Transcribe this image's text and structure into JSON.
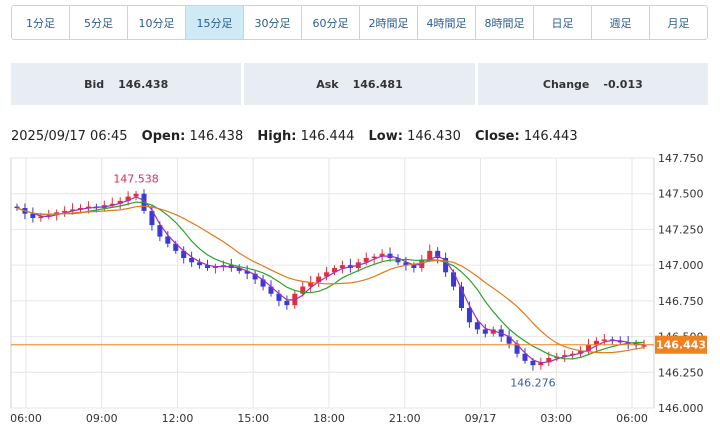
{
  "tabs": [
    {
      "label": "1分足",
      "active": false
    },
    {
      "label": "5分足",
      "active": false
    },
    {
      "label": "10分足",
      "active": false
    },
    {
      "label": "15分足",
      "active": true
    },
    {
      "label": "30分足",
      "active": false
    },
    {
      "label": "60分足",
      "active": false
    },
    {
      "label": "2時間足",
      "active": false
    },
    {
      "label": "4時間足",
      "active": false
    },
    {
      "label": "8時間足",
      "active": false
    },
    {
      "label": "日足",
      "active": false
    },
    {
      "label": "週足",
      "active": false
    },
    {
      "label": "月足",
      "active": false
    }
  ],
  "quotes": {
    "bid_label": "Bid",
    "bid_value": "146.438",
    "ask_label": "Ask",
    "ask_value": "146.481",
    "change_label": "Change",
    "change_value": "-0.013"
  },
  "ohlc": {
    "datetime": "2025/09/17 06:45",
    "open_label": "Open:",
    "open": "146.438",
    "high_label": "High:",
    "high": "146.444",
    "low_label": "Low:",
    "low": "146.430",
    "close_label": "Close:",
    "close": "146.443"
  },
  "chart_data": {
    "type": "candlestick",
    "y_ticks": [
      "147.750",
      "147.500",
      "147.250",
      "147.000",
      "146.750",
      "146.500",
      "146.250",
      "146.000"
    ],
    "ylim": [
      146.0,
      147.75
    ],
    "x_ticks": [
      "06:00",
      "09:00",
      "12:00",
      "15:00",
      "18:00",
      "21:00",
      "09/17",
      "03:00",
      "06:00"
    ],
    "current_price": "146.443",
    "high_annotation": "147.538",
    "low_annotation": "146.276",
    "colors": {
      "up": "#e0303c",
      "down": "#3a3ad0",
      "ma_fast": "#9b2fc9",
      "ma_mid": "#2aa52a",
      "ma_slow": "#e07a1a",
      "price_line": "#f08020",
      "grid": "#e6e6e6"
    },
    "closes": [
      147.4,
      147.36,
      147.33,
      147.34,
      147.35,
      147.37,
      147.38,
      147.39,
      147.4,
      147.41,
      147.4,
      147.42,
      147.43,
      147.45,
      147.48,
      147.5,
      147.38,
      147.28,
      147.2,
      147.15,
      147.1,
      147.05,
      147.02,
      147.0,
      146.98,
      146.99,
      147.0,
      146.98,
      146.96,
      146.94,
      146.9,
      146.85,
      146.8,
      146.75,
      146.72,
      146.8,
      146.85,
      146.88,
      146.92,
      146.95,
      146.98,
      147.0,
      146.98,
      147.02,
      147.05,
      147.06,
      147.08,
      147.05,
      147.02,
      147.0,
      146.98,
      147.04,
      147.1,
      147.05,
      146.95,
      146.85,
      146.7,
      146.6,
      146.55,
      146.52,
      146.55,
      146.5,
      146.45,
      146.38,
      146.33,
      146.3,
      146.32,
      146.35,
      146.36,
      146.37,
      146.38,
      146.4,
      146.44,
      146.47,
      146.48,
      146.47,
      146.46,
      146.45,
      146.44,
      146.44
    ]
  }
}
